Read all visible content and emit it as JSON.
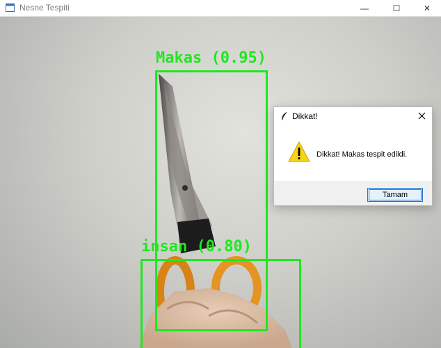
{
  "window": {
    "title": "Nesne Tespiti",
    "controls": [
      "minimize",
      "maximize",
      "close"
    ],
    "minimize_glyph": "—",
    "maximize_glyph": "☐",
    "close_glyph": "✕"
  },
  "detections": [
    {
      "label": "Makas (0.95)",
      "color": "#1ee81e"
    },
    {
      "label": "insan (0.80)",
      "color": "#1ee81e"
    }
  ],
  "dialog": {
    "title": "Dikkat!",
    "message": "Dikkat! Makas tespit edildi.",
    "ok_label": "Tamam",
    "icon": "warning-icon"
  },
  "colors": {
    "box": "#1ee81e",
    "button_border": "#1e76d6"
  }
}
